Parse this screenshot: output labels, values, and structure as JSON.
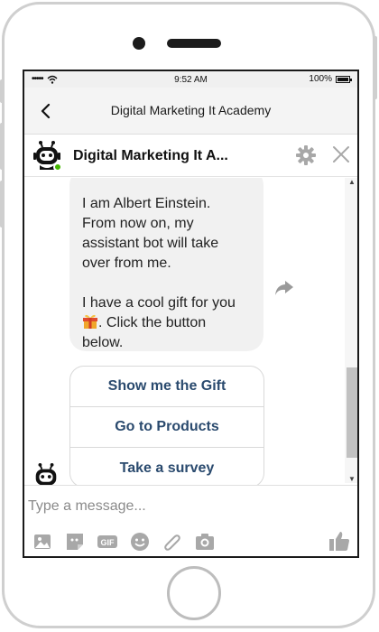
{
  "status_bar": {
    "signal": "•••••",
    "time": "9:52 AM",
    "battery": "100%"
  },
  "nav": {
    "title": "Digital Marketing It Academy"
  },
  "chat_header": {
    "title": "Digital Marketing It A..."
  },
  "messages": {
    "bubble": {
      "line1": "I am Albert Einstein.",
      "line2": "From now on, my",
      "line3": "assistant bot will take",
      "line4": "over from me.",
      "line5": "I have a cool gift for you",
      "line6_after_gift": ". Click the button",
      "line7": "below."
    }
  },
  "quick_replies": [
    "Show me the Gift",
    "Go to Products",
    "Take a survey"
  ],
  "composer": {
    "placeholder": "Type a message..."
  },
  "colors": {
    "accent": "#2a4a6e",
    "bubble_bg": "#f1f1f1",
    "online": "#44b700",
    "icon_gray": "#a8a8a8"
  },
  "icons": [
    "back-icon",
    "bot-avatar",
    "gear-icon",
    "close-icon",
    "gift-icon",
    "share-icon",
    "photo-icon",
    "sticker-icon",
    "gif-icon",
    "emoji-icon",
    "attachment-icon",
    "camera-icon",
    "like-icon"
  ]
}
